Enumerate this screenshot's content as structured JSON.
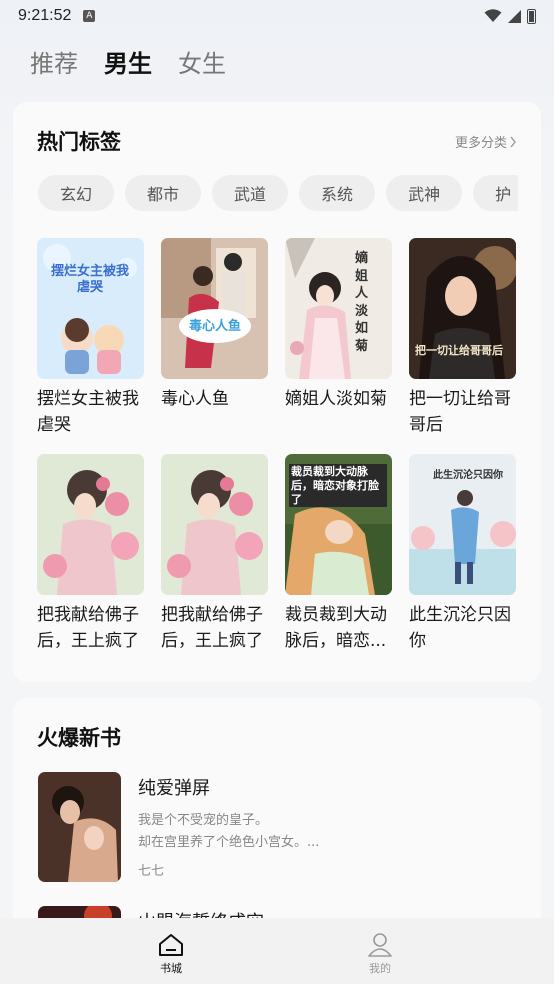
{
  "status_bar": {
    "time": "9:21:52",
    "notification_icon": "A"
  },
  "top_tabs": [
    {
      "label": "推荐",
      "active": false
    },
    {
      "label": "男生",
      "active": true
    },
    {
      "label": "女生",
      "active": false
    }
  ],
  "hot_tags": {
    "title": "热门标签",
    "more": "更多分类",
    "tags": [
      "玄幻",
      "都市",
      "武道",
      "系统",
      "武神",
      "护"
    ],
    "books": [
      {
        "name": "摆烂女主被我虐哭",
        "cover_text": "摆烂女主被我虐哭"
      },
      {
        "name": "毒心人鱼",
        "cover_text": "毒心人鱼"
      },
      {
        "name": "嫡姐人淡如菊",
        "cover_text": "嫡姐人淡如菊"
      },
      {
        "name": "把一切让给哥哥后",
        "cover_text": "把一切让给哥哥后"
      },
      {
        "name": "把我献给佛子后，王上疯了",
        "cover_text": ""
      },
      {
        "name": "把我献给佛子后，王上疯了",
        "cover_text": ""
      },
      {
        "name": "裁员裁到大动脉后，暗恋...",
        "cover_text": "裁员裁到大动脉后，暗恋对象打脸了"
      },
      {
        "name": "此生沉沦只因你",
        "cover_text": "此生沉沦只因你"
      }
    ]
  },
  "new_books": {
    "title": "火爆新书",
    "items": [
      {
        "title": "纯爱弹屏",
        "desc_line1": "我是个不受宠的皇子。",
        "desc_line2": "却在宫里养了个绝色小宫女。...",
        "author": "七七"
      },
      {
        "title": "山盟海誓终成空"
      }
    ]
  },
  "bottom_nav": [
    {
      "label": "书城",
      "icon": "home-icon",
      "active": true
    },
    {
      "label": "我的",
      "icon": "person-icon",
      "active": false
    }
  ]
}
